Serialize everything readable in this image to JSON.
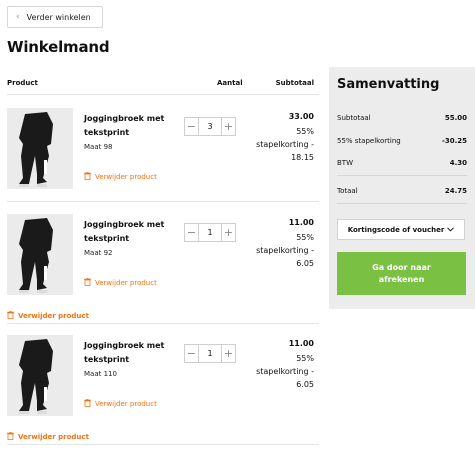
{
  "nav": {
    "back_label": "Verder winkelen"
  },
  "page": {
    "title": "Winkelmand"
  },
  "table": {
    "col_product": "Product",
    "col_qty": "Aantal",
    "col_subtotal": "Subtotaal"
  },
  "items": [
    {
      "name": "Joggingbroek met tekstprint",
      "size": "Maat 98",
      "qty": "3",
      "price": "33.00",
      "discount_pct": "55%",
      "discount_line1": "stapelkorting -",
      "discount_amount": "18.15",
      "remove_label": "Verwijder product"
    },
    {
      "name": "Joggingbroek met tekstprint",
      "size": "Maat 92",
      "qty": "1",
      "price": "11.00",
      "discount_pct": "55%",
      "discount_line1": "stapelkorting -",
      "discount_amount": "6.05",
      "remove_label": "Verwijder product"
    },
    {
      "name": "Joggingbroek met tekstprint",
      "size": "Maat 110",
      "qty": "1",
      "price": "11.00",
      "discount_pct": "55%",
      "discount_line1": "stapelkorting -",
      "discount_amount": "6.05",
      "remove_label": "Verwijder product"
    }
  ],
  "bundle_remove_labels": [
    "Verwijder product",
    "Verwijder product"
  ],
  "stepper": {
    "minus": "−",
    "plus": "+"
  },
  "summary": {
    "title": "Samenvatting",
    "subtotal_label": "Subtotaal",
    "subtotal_value": "55.00",
    "discount_label": "55% stapelkorting",
    "discount_value": "-30.25",
    "vat_label": "BTW",
    "vat_value": "4.30",
    "total_label": "Totaal",
    "total_value": "24.75",
    "coupon_label": "Kortingscode of voucher",
    "checkout_label": "Ga door naar afrekenen"
  },
  "icons": {
    "back": "chevron-left-icon",
    "remove": "trash-icon",
    "coupon": "chevron-down-icon"
  },
  "colors": {
    "accent_orange": "#f27314",
    "checkout_green": "#7ac143",
    "summary_bg": "#ececec"
  }
}
